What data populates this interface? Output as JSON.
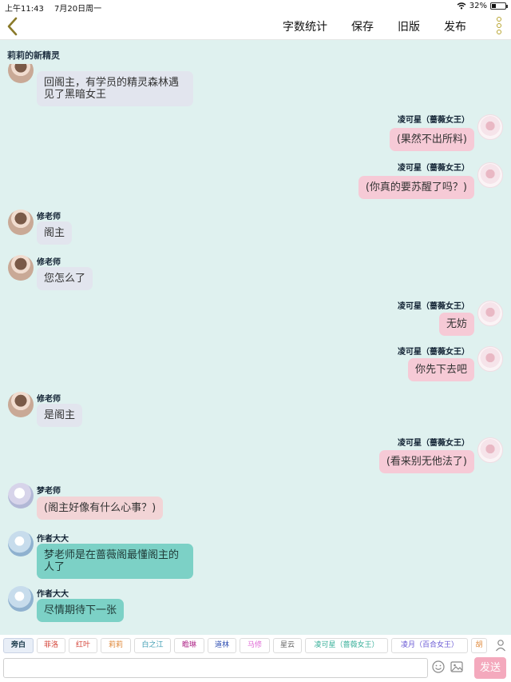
{
  "status_bar": {
    "time": "上午11:43",
    "date": "7月20日周一",
    "battery": "32%",
    "battery_level": 0.32
  },
  "nav": {
    "word_count": "字数统计",
    "save": "保存",
    "old_version": "旧版",
    "publish": "发布"
  },
  "story_title": "莉莉的新精灵",
  "messages": [
    {
      "speaker": "",
      "text": "回阁主，有学员的精灵森林遇见了黑暗女王"
    },
    {
      "speaker": "凌可星（蔷薇女王）",
      "text": "(果然不出所料)"
    },
    {
      "speaker": "凌可星（蔷薇女王）",
      "text": "(你真的要苏醒了吗？)"
    },
    {
      "speaker": "修老师",
      "text": "阁主"
    },
    {
      "speaker": "修老师",
      "text": "您怎么了"
    },
    {
      "speaker": "凌可星（蔷薇女王）",
      "text": "无妨"
    },
    {
      "speaker": "凌可星（蔷薇女王）",
      "text": "你先下去吧"
    },
    {
      "speaker": "修老师",
      "text": "是阁主"
    },
    {
      "speaker": "凌可星（蔷薇女王）",
      "text": "(看来别无他法了)"
    },
    {
      "speaker": "梦老师",
      "text": "(阁主好像有什么心事？)"
    },
    {
      "speaker": "作者大大",
      "text": "梦老师是在蔷薇阁最懂阁主的人了"
    },
    {
      "speaker": "作者大大",
      "text": "尽情期待下一张"
    }
  ],
  "characters": [
    {
      "label": "旁白",
      "color": "#123344"
    },
    {
      "label": "菲洛",
      "color": "#d4453a"
    },
    {
      "label": "红叶",
      "color": "#d4453a"
    },
    {
      "label": "莉莉",
      "color": "#e08a3c"
    },
    {
      "label": "白之江",
      "color": "#3a9ab0"
    },
    {
      "label": "瞻琳",
      "color": "#b02a8a"
    },
    {
      "label": "道林",
      "color": "#2a4ab0"
    },
    {
      "label": "马修",
      "color": "#e06ad6"
    },
    {
      "label": "星云",
      "color": "#666666"
    },
    {
      "label": "凌可星（蔷薇女王）",
      "color": "#3ab09a"
    },
    {
      "label": "凌月（百合女王）",
      "color": "#6a5ad4"
    },
    {
      "label": "胡",
      "color": "#e08a3c"
    }
  ],
  "input": {
    "placeholder": "",
    "send_label": "发送"
  },
  "colors": {
    "accent": "#f4a9bd",
    "background": "#dff1ef",
    "back_arrow": "#8a7a2a"
  }
}
